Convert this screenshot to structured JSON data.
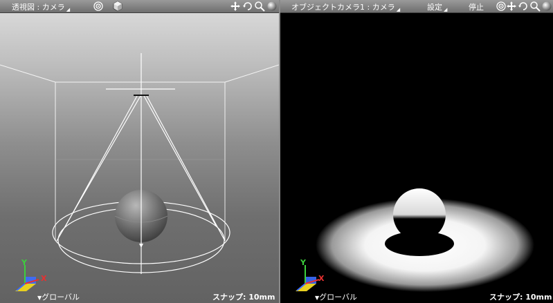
{
  "left_view": {
    "title": "透視図 : カメラ",
    "coordinate_system": "グローバル",
    "snap_label": "スナップ:",
    "snap_value": "10mm",
    "axes": {
      "y": "Y",
      "x": "X"
    }
  },
  "right_view": {
    "title": "オブジェクトカメラ1 : カメラ",
    "menu_settings": "設定",
    "menu_stop": "停止",
    "coordinate_system": "グローバル",
    "snap_label": "スナップ:",
    "snap_value": "10mm",
    "axes": {
      "y": "Y",
      "x": "X"
    }
  },
  "colors": {
    "axis_x": "#e83030",
    "axis_y": "#3cd03c",
    "axis_z": "#3c6cff",
    "plane": "#e8d020",
    "wire": "#ffffff"
  },
  "icons": [
    "target-icon",
    "cube-icon",
    "move-icon",
    "rotate-icon",
    "zoom-icon",
    "sphere-icon"
  ]
}
